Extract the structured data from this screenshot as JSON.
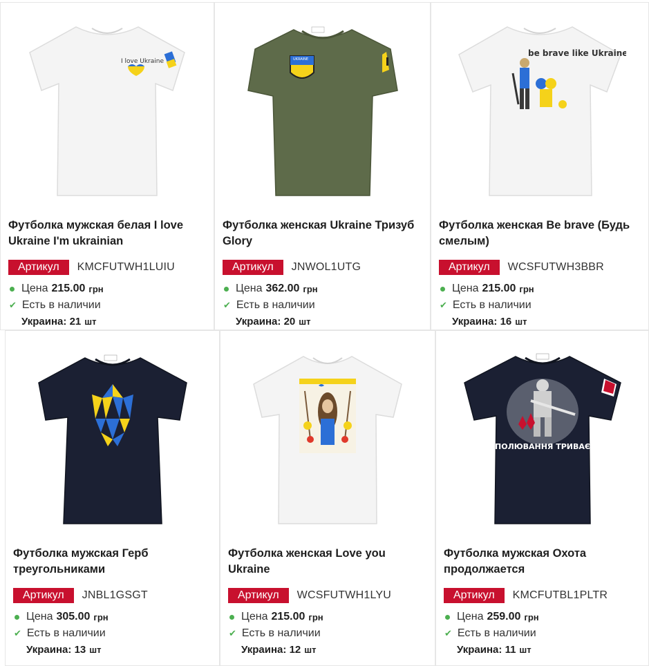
{
  "common": {
    "sku_badge": "Артикул",
    "price_label": "Цена",
    "currency": "грн",
    "in_stock": "Есть в наличии",
    "unit": "шт",
    "colors": {
      "badge": "#c8102e",
      "status_green": "#4caf50"
    }
  },
  "products": [
    {
      "title": "Футболка мужская белая I love Ukraine I'm ukrainian",
      "sku": "KMCFUTWH1LUIU",
      "price": "215.00",
      "warehouse": "Украина:",
      "qty": "21",
      "shirt_color": "#f4f4f4",
      "print_text": "I love Ukraine"
    },
    {
      "title": "Футболка женская Ukraine Тризуб Glory",
      "sku": "JNWOL1UTG",
      "price": "362.00",
      "warehouse": "Украина:",
      "qty": "20",
      "shirt_color": "#5e6b4a",
      "print_text": "UKRAINE"
    },
    {
      "title": "Футболка женская Be brave (Будь смелым)",
      "sku": "WCSFUTWH3BBR",
      "price": "215.00",
      "warehouse": "Украина:",
      "qty": "16",
      "shirt_color": "#f4f4f4",
      "print_text": "be brave like Ukraine"
    },
    {
      "title": "Футболка мужская Герб треугольниками",
      "sku": "JNBL1GSGT",
      "price": "305.00",
      "warehouse": "Украина:",
      "qty": "13",
      "shirt_color": "#1b2033",
      "print_text": ""
    },
    {
      "title": "Футболка женская Love you Ukraine",
      "sku": "WCSFUTWH1LYU",
      "price": "215.00",
      "warehouse": "Украина:",
      "qty": "12",
      "shirt_color": "#f4f4f4",
      "print_text": ""
    },
    {
      "title": "Футболка мужская Охота продолжается",
      "sku": "KMCFUTBL1PLTR",
      "price": "259.00",
      "warehouse": "Украина:",
      "qty": "11",
      "shirt_color": "#1b2033",
      "print_text": "ПОЛЮВАННЯ ТРИВАЄ"
    }
  ]
}
